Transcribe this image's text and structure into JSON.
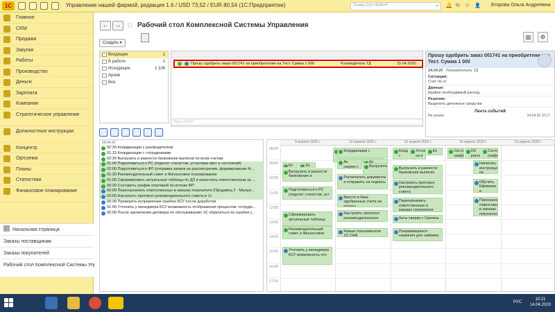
{
  "titlebar": {
    "title": "Управление нашей фирмой, редакция 1.6 / USD 73,52 / EUR 80,54  (1С:Предприятие)",
    "search_placeholder": "Поиск Ctrl+Shift+F",
    "user": "Егорова Ольга Андреевна"
  },
  "sidebar": {
    "items": [
      {
        "label": "Главное",
        "color": "#c9a51a"
      },
      {
        "label": "CRM",
        "color": "#c9a51a"
      },
      {
        "label": "Продажи",
        "color": "#c9a51a"
      },
      {
        "label": "Закупки",
        "color": "#c9a51a"
      },
      {
        "label": "Работы",
        "color": "#c9a51a"
      },
      {
        "label": "Производство",
        "color": "#c9a51a"
      },
      {
        "label": "Деньги",
        "color": "#c9a51a"
      },
      {
        "label": "Зарплата",
        "color": "#c9a51a"
      },
      {
        "label": "Компания",
        "color": "#c9a51a"
      },
      {
        "label": "Стратегическое управление",
        "color": "#c9a51a"
      },
      {
        "label": "Должностные инструкции",
        "color": "#c9a51a"
      },
      {
        "label": "Концентр",
        "color": "#c9a51a"
      },
      {
        "label": "Оргсхема",
        "color": "#c9a51a"
      },
      {
        "label": "Планы",
        "color": "#c9a51a"
      },
      {
        "label": "Статистики",
        "color": "#c9a51a"
      },
      {
        "label": "Финансовое планирование",
        "color": "#c9a51a"
      }
    ],
    "links": [
      {
        "label": "Начальная страница"
      },
      {
        "label": "Заказы поставщикам"
      },
      {
        "label": "Заказы покупателей"
      },
      {
        "label": "Рабочий стол Комплексной Системы Управления"
      }
    ]
  },
  "header": {
    "title": "Рабочий стол Комплексной Системы Управления",
    "create_label": "Создать"
  },
  "folders": [
    {
      "label": "Входящие",
      "count": "1"
    },
    {
      "label": "В работе",
      "count": "1"
    },
    {
      "label": "Исходящие",
      "count": "1 106"
    },
    {
      "label": "Архив",
      "count": ""
    },
    {
      "label": "Все",
      "count": ""
    }
  ],
  "tasks": {
    "row": {
      "title": "Прошу одобрить заказ 001741 на приобретение на Тест. Сумма 1 000",
      "role": "Руководитель ТД",
      "date": "15.04.2020"
    },
    "search_placeholder": "Поиск Ctrl+F"
  },
  "detail": {
    "title": "Прошу одобрить заказ 001741 на приобретение на Тест. Сумма 1 000",
    "meta_date": "14.04.20",
    "meta_role": "Руководитель ТД",
    "situation_label": "Ситуация:",
    "situation_value": "Счет № от",
    "data_label": "Данные:",
    "data_value": "Крайне необходимый расход",
    "decision_label": "Решение:",
    "decision_value": "Выделить денежные средства",
    "feed_title": "Лента событий",
    "feed_left": "Не указан",
    "feed_right": "14.04.20 10:17"
  },
  "list": {
    "date": "09.04.20",
    "rows": [
      {
        "text": "02:30 Координации с руководителем",
        "type": "g",
        "hl": false
      },
      {
        "text": "01:15 Координации с сотрудниками",
        "type": "g",
        "hl": false
      },
      {
        "text": "02:30 Выгрузить и разнести банковские выписки по всем счетам",
        "type": "g",
        "hl": false
      },
      {
        "text": "01:00 Подготовиться к РС (подсчет статистик, установка квот и состояний)",
        "type": "g",
        "hl": true
      },
      {
        "text": "02:00 Подготовиться к ФП (отправка заявок на рассмотрение, формирование Ф...",
        "type": "g",
        "hl": true
      },
      {
        "text": "01:30 Рекомендательный совет и Финансовое планирование",
        "type": "g",
        "hl": true
      },
      {
        "text": "01:00 Сформировать актуальные таблицы по ДЗ и разослать ответственным за ...",
        "type": "g",
        "hl": true
      },
      {
        "text": "00:20 Составить график платежей по итогам ФП",
        "type": "g",
        "hl": true
      },
      {
        "text": "00:00 Переназначить ответственных в заказах покупателя (Продавец 2 - Малых...",
        "type": "b",
        "hl": true
      },
      {
        "text": "03:00 Настроить протокол рекомендательного совета в 1с",
        "type": "b",
        "hl": true
      },
      {
        "text": "00:30 Проверить исправление ошибок КСУ после доработки",
        "type": "b",
        "hl": false
      },
      {
        "text": "01:00 Уточнить у менеджера КСУ возможность отображения процессов: сотрудн...",
        "type": "b",
        "hl": false
      },
      {
        "text": "00:00 После заключения договора по обслуживанию 1С обратиться по ошибке (...",
        "type": "b",
        "hl": false
      }
    ]
  },
  "calendar": {
    "days": [
      "9 апреля 2020 г.",
      "10 апреля 2020 г.",
      "13 апреля 2020 г.",
      "14 апреля 2020 г.",
      "15 апреля 2020 г."
    ],
    "times": [
      "08:00",
      "09:00",
      "10:00",
      "11:00",
      "12:00",
      "13:00",
      "14:00",
      "15:00",
      "16:00",
      "17:00"
    ],
    "events": [
      {
        "day": 0,
        "slot": 0.15,
        "h": 1.0,
        "text": "Координации",
        "type": "g",
        "sub": 1,
        "subs": 1
      },
      {
        "day": 0,
        "slot": 1.15,
        "h": 0.35,
        "text": "Ко",
        "type": "g",
        "sub": 0,
        "subs": 3
      },
      {
        "day": 0,
        "slot": 1.15,
        "h": 0.35,
        "text": "Ко динации",
        "type": "g",
        "sub": 1,
        "subs": 3
      },
      {
        "day": 0,
        "slot": 1.55,
        "h": 0.9,
        "text": "Выгрузить и разнести банковские в",
        "type": "g",
        "sub": 0,
        "subs": 1
      },
      {
        "day": 0,
        "slot": 2.8,
        "h": 0.9,
        "text": "Подготовиться к РС (подсчет статистик, уст",
        "type": "g",
        "sub": 0,
        "subs": 1
      },
      {
        "day": 0,
        "slot": 4.5,
        "h": 0.95,
        "text": "Сформировать актуальные таблицы",
        "type": "g",
        "sub": 0,
        "subs": 1
      },
      {
        "day": 0,
        "slot": 5.45,
        "h": 0.9,
        "text": "Рекомендательный совет и Финансовое",
        "type": "g",
        "sub": 0,
        "subs": 1
      },
      {
        "day": 0,
        "slot": 6.9,
        "h": 1.2,
        "text": "Уточнить у менеджера КСУ возможность ото",
        "type": "b",
        "sub": 0,
        "subs": 1
      },
      {
        "day": 1,
        "slot": 0.15,
        "h": 0.7,
        "text": "Координации с",
        "type": "g",
        "sub": 0,
        "subs": 1
      },
      {
        "day": 1,
        "slot": 0.9,
        "h": 0.7,
        "text": "Ак сверки с",
        "type": "g",
        "sub": 0,
        "subs": 2
      },
      {
        "day": 1,
        "slot": 0.9,
        "h": 0.7,
        "text": "Ко",
        "type": "g",
        "sub": 1,
        "subs": 2
      },
      {
        "day": 1,
        "slot": 1.2,
        "h": 0.8,
        "text": "Выгрузить",
        "type": "g",
        "sub": 1,
        "subs": 2
      },
      {
        "day": 1,
        "slot": 1.95,
        "h": 1.0,
        "text": "Распечатать документы и отправить на подпись",
        "type": "b",
        "sub": 0,
        "subs": 1
      },
      {
        "day": 1,
        "slot": 3.3,
        "h": 0.9,
        "text": "Ввести в банк одобренные счета на оплату",
        "type": "b",
        "sub": 0,
        "subs": 1
      },
      {
        "day": 1,
        "slot": 4.4,
        "h": 0.8,
        "text": "Настроить протокол рекомендательного совета",
        "type": "b",
        "sub": 0,
        "subs": 1
      },
      {
        "day": 1,
        "slot": 5.6,
        "h": 0.65,
        "text": "Новые пользователи 1С:УНФ",
        "type": "b",
        "sub": 0,
        "subs": 1
      },
      {
        "day": 2,
        "slot": 0.15,
        "h": 0.8,
        "text": "Координации с",
        "type": "g",
        "sub": 0,
        "subs": 3
      },
      {
        "day": 2,
        "slot": 0.15,
        "h": 0.8,
        "text": "Устная ка и подыски",
        "type": "g",
        "sub": 1,
        "subs": 3
      },
      {
        "day": 2,
        "slot": 0.15,
        "h": 0.5,
        "text": "Ко",
        "type": "g",
        "sub": 2,
        "subs": 3
      },
      {
        "day": 2,
        "slot": 1.3,
        "h": 0.95,
        "text": "Выгрузить и разнести банковские выписки",
        "type": "g",
        "sub": 0,
        "subs": 1
      },
      {
        "day": 2,
        "slot": 2.3,
        "h": 1.0,
        "text": "Настроить протокол рекомендательного совета",
        "type": "b",
        "sub": 0,
        "subs": 1
      },
      {
        "day": 2,
        "slot": 3.55,
        "h": 1.0,
        "text": "Переназначить ответственных в заказах покупателя",
        "type": "b",
        "sub": 0,
        "subs": 1
      },
      {
        "day": 2,
        "slot": 4.7,
        "h": 0.6,
        "text": "Акты сверки с Гранель",
        "type": "b",
        "sub": 0,
        "subs": 1
      },
      {
        "day": 2,
        "slot": 5.6,
        "h": 0.9,
        "text": "Понравившиеся названия для наймика",
        "type": "b",
        "sub": 0,
        "subs": 1
      },
      {
        "day": 3,
        "slot": 0.15,
        "h": 0.75,
        "text": "Составить график",
        "type": "g",
        "sub": 0,
        "subs": 3
      },
      {
        "day": 3,
        "slot": 0.15,
        "h": 0.75,
        "text": "Об ректи",
        "type": "g",
        "sub": 1,
        "subs": 3
      },
      {
        "day": 3,
        "slot": 0.15,
        "h": 0.75,
        "text": "Составить график",
        "type": "g",
        "sub": 2,
        "subs": 3
      },
      {
        "day": 3,
        "slot": 1.0,
        "h": 0.95,
        "text": "Написать инструкцию по утверждению заявок на",
        "type": "b",
        "sub": 1,
        "subs": 2
      },
      {
        "day": 3,
        "slot": 2.25,
        "h": 0.95,
        "text": "Обучить Ефимова и Малыхину вводу заявок чере",
        "type": "b",
        "sub": 1,
        "subs": 2
      },
      {
        "day": 3,
        "slot": 3.5,
        "h": 1.3,
        "text": "Переназначить ответственных в заказах покупателя (Продавец 2 - Малыхина К.Ю.)",
        "type": "b",
        "sub": 1,
        "subs": 2
      }
    ]
  },
  "tray": {
    "lang": "РУС",
    "time": "10:21",
    "date": "14.04.2020"
  }
}
